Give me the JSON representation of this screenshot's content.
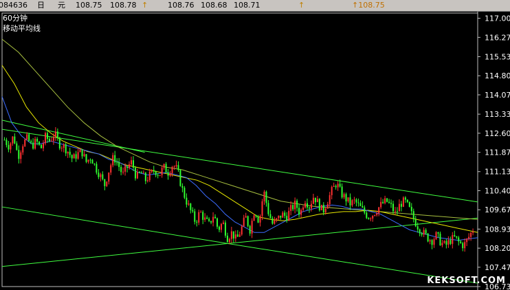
{
  "topbar": {
    "code": "084636",
    "period_char": "日",
    "currency_char": "元",
    "v1": "108.75",
    "v2": "108.78",
    "a1": "↑",
    "v3": "108.76",
    "v4": "108.68",
    "v5": "108.71",
    "a2": "↑",
    "last": "↑108.75"
  },
  "legend": {
    "timeframe": "60分钟",
    "indicator": "移动平均线"
  },
  "watermark": "KEKSOFT.COM",
  "colors": {
    "background": "#000000",
    "candle_up": "#ff3030",
    "candle_down": "#30ff30",
    "ma_short": "#3c6cff",
    "ma_mid": "#e8e800",
    "ma_long": "#a8c040",
    "trendline": "#40ff40",
    "axis": "#c0c0c0"
  },
  "chart_data": {
    "type": "candlestick",
    "title": "",
    "ylim": [
      106.73,
      117.2
    ],
    "yticks": [
      "117.00",
      "116.27",
      "115.53",
      "114.80",
      "114.07",
      "113.33",
      "112.60",
      "111.87",
      "111.13",
      "110.40",
      "109.67",
      "108.93",
      "108.20",
      "107.47",
      "106.73"
    ],
    "close_path": [
      112.35,
      112.1,
      112.5,
      111.7,
      112.2,
      112.4,
      112.1,
      112.3,
      112.0,
      112.45,
      112.3,
      112.6,
      112.2,
      112.1,
      111.9,
      111.6,
      111.8,
      111.9,
      111.5,
      111.7,
      111.3,
      111.0,
      110.6,
      111.2,
      111.7,
      111.4,
      111.0,
      111.3,
      111.5,
      110.9,
      111.1,
      110.8,
      111.0,
      111.2,
      111.0,
      111.3,
      111.1,
      111.4,
      111.2,
      110.5,
      110.0,
      109.6,
      109.2,
      109.6,
      109.3,
      109.1,
      109.5,
      108.9,
      109.2,
      108.6,
      108.8,
      108.5,
      108.9,
      109.4,
      108.9,
      109.7,
      109.2,
      110.4,
      109.6,
      109.1,
      109.3,
      109.5,
      109.4,
      109.7,
      109.9,
      109.5,
      110.1,
      109.8,
      110.2,
      109.9,
      109.6,
      110.0,
      110.4,
      110.7,
      110.3,
      110.1,
      109.9,
      110.0,
      109.8,
      109.6,
      109.4,
      109.5,
      109.7,
      109.9,
      110.0,
      109.8,
      109.5,
      109.9,
      110.0,
      109.7,
      109.3,
      109.0,
      108.8,
      108.6,
      108.5,
      108.7,
      108.4,
      108.3,
      108.5,
      108.6,
      108.4,
      108.3,
      108.6,
      108.9
    ],
    "ma_short_path": [
      114.0,
      113.0,
      112.5,
      112.2,
      112.2,
      112.3,
      112.2,
      112.1,
      112.0,
      111.9,
      111.8,
      111.6,
      111.5,
      111.3,
      111.1,
      111.0,
      111.05,
      111.1,
      111.0,
      110.9,
      110.6,
      110.2,
      109.9,
      109.5,
      109.2,
      109.0,
      108.8,
      108.8,
      109.0,
      109.2,
      109.4,
      109.6,
      109.7,
      109.8,
      109.85,
      109.8,
      109.7,
      109.7,
      109.6,
      109.5,
      109.3,
      109.1,
      108.9,
      108.8,
      108.7,
      108.6,
      108.55,
      108.5,
      108.55,
      108.6
    ],
    "ma_mid_path": [
      115.2,
      114.5,
      113.6,
      113.0,
      112.6,
      112.3,
      112.1,
      111.9,
      111.8,
      111.6,
      111.4,
      111.3,
      111.2,
      111.1,
      111.0,
      110.9,
      110.8,
      110.6,
      110.3,
      110.0,
      109.7,
      109.4,
      109.3,
      109.25,
      109.3,
      109.4,
      109.5,
      109.55,
      109.6,
      109.6,
      109.65,
      109.6,
      109.5,
      109.4,
      109.3,
      109.2,
      109.1,
      109.0,
      108.9,
      108.8
    ],
    "ma_long_path": [
      116.2,
      115.7,
      115.0,
      114.3,
      113.6,
      113.0,
      112.5,
      112.1,
      111.8,
      111.5,
      111.3,
      111.2,
      111.0,
      110.8,
      110.6,
      110.4,
      110.2,
      110.0,
      109.9,
      109.8,
      109.75,
      109.7,
      109.65,
      109.6,
      109.55,
      109.5,
      109.45,
      109.4,
      109.35,
      109.3
    ],
    "trendlines": [
      {
        "x1": 0.0,
        "y1": 112.75,
        "x2": 1.0,
        "y2": 109.97
      },
      {
        "x1": 0.0,
        "y1": 109.78,
        "x2": 0.48,
        "y2": 108.36
      },
      {
        "x1": 0.48,
        "y1": 108.36,
        "x2": 1.0,
        "y2": 106.86
      },
      {
        "x1": 0.0,
        "y1": 107.5,
        "x2": 1.0,
        "y2": 109.35
      },
      {
        "x1": 0.0,
        "y1": 113.1,
        "x2": 0.3,
        "y2": 111.87
      }
    ]
  }
}
